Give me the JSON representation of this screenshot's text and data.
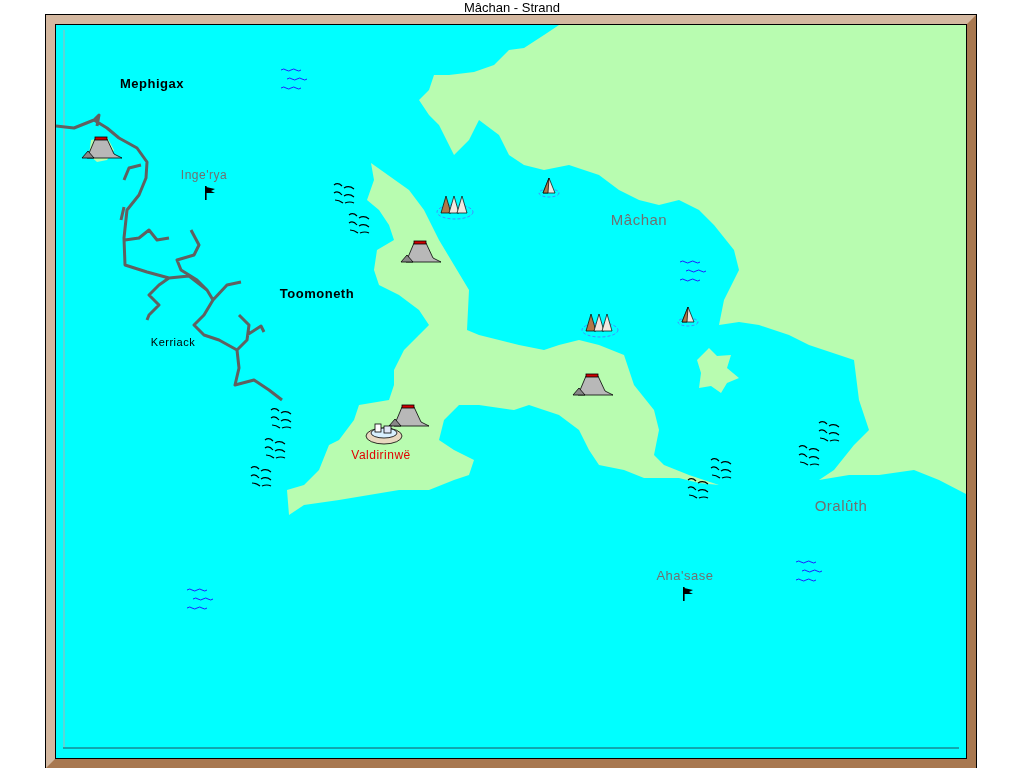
{
  "window": {
    "title": "Mâchan - Strand"
  },
  "labels": [
    {
      "name": "Mephigax",
      "color": "#000000"
    },
    {
      "name": "Inge'rya",
      "color": "#707070"
    },
    {
      "name": "Toomoneth",
      "color": "#000000"
    },
    {
      "name": "Kerriack",
      "color": "#000000"
    },
    {
      "name": "Mâchan",
      "color": "#707070"
    },
    {
      "name": "Valdirinwë",
      "color": "#e00000"
    },
    {
      "name": "Oralûth",
      "color": "#707070"
    },
    {
      "name": "Aha'sase",
      "color": "#707070"
    }
  ]
}
